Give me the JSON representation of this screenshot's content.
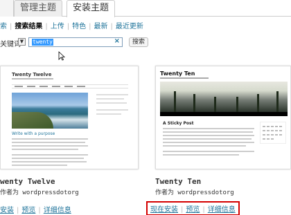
{
  "tabs": [
    {
      "label": "管理主题",
      "active": false
    },
    {
      "label": "安装主题",
      "active": true
    }
  ],
  "subnav": {
    "items": [
      "索",
      "搜索结果",
      "上传",
      "特色",
      "最新",
      "最近更新"
    ],
    "current_index": 1
  },
  "search": {
    "type_label": "关键词",
    "value": "twenty",
    "button_label": "搜索",
    "clear_icon": "×"
  },
  "themes": [
    {
      "name": "wenty Twelve",
      "author": "作者为 wordpressdotorg",
      "preview_title": "Twenty Twelve",
      "preview_post": "Write with a purpose",
      "actions": [
        "安装",
        "预览",
        "详细信息"
      ]
    },
    {
      "name": "Twenty Ten",
      "author": "作者为 wordpressdotorg",
      "preview_title": "Twenty Ten",
      "preview_post": "A Sticky Post",
      "actions": [
        "现在安装",
        "预览",
        "详细信息"
      ],
      "highlight_color": "#d40000"
    }
  ]
}
